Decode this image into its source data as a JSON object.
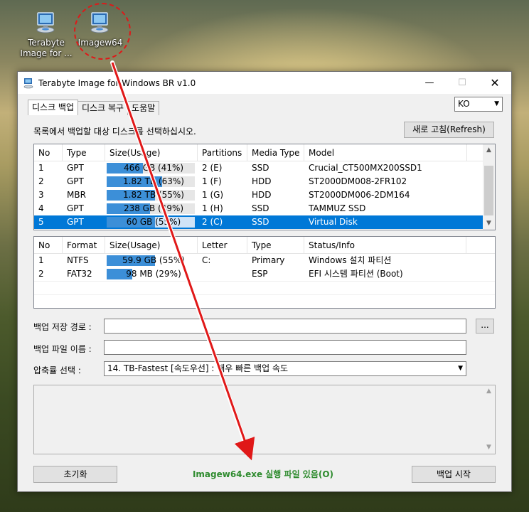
{
  "desktop": {
    "icons": [
      {
        "label_line1": "Terabyte",
        "label_line2": "Image for ...",
        "icon": "computer-disk-icon"
      },
      {
        "label_line1": "Imagew64",
        "label_line2": "",
        "icon": "computer-disk-icon"
      }
    ],
    "highlight_color": "#e01818"
  },
  "window": {
    "title": "Terabyte Image for Windows BR v1.0",
    "controls": {
      "minimize": "—",
      "maximize": "☐",
      "close": "✕"
    },
    "tabs": [
      {
        "label": "디스크 백업",
        "active": true
      },
      {
        "label": "디스크 복구",
        "active": false
      },
      {
        "label": "도움말",
        "active": false
      }
    ],
    "language": {
      "selected": "KO"
    },
    "instruction": "목록에서 백업할 대상 디스크를 선택하십시오.",
    "refresh_button": "새로 고침(Refresh)",
    "disks": {
      "columns": [
        "No",
        "Type",
        "Size(Usage)",
        "Partitions",
        "Media Type",
        "Model"
      ],
      "rows": [
        {
          "no": "1",
          "type": "GPT",
          "size": "466 GB (41%)",
          "usage": 41,
          "partitions": "2 (E)",
          "media": "SSD",
          "model": "Crucial_CT500MX200SSD1",
          "selected": false
        },
        {
          "no": "2",
          "type": "GPT",
          "size": "1.82 TB (63%)",
          "usage": 63,
          "partitions": "1 (F)",
          "media": "HDD",
          "model": "ST2000DM008-2FR102",
          "selected": false
        },
        {
          "no": "3",
          "type": "MBR",
          "size": "1.82 TB (55%)",
          "usage": 55,
          "partitions": "1 (G)",
          "media": "HDD",
          "model": "ST2000DM006-2DM164",
          "selected": false
        },
        {
          "no": "4",
          "type": "GPT",
          "size": "238 GB (49%)",
          "usage": 49,
          "partitions": "1 (H)",
          "media": "SSD",
          "model": "TAMMUZ SSD",
          "selected": false
        },
        {
          "no": "5",
          "type": "GPT",
          "size": "60 GB (55%)",
          "usage": 55,
          "partitions": "2 (C)",
          "media": "SSD",
          "model": "Virtual Disk",
          "selected": true
        }
      ]
    },
    "partitions": {
      "columns": [
        "No",
        "Format",
        "Size(Usage)",
        "Letter",
        "Type",
        "Status/Info"
      ],
      "rows": [
        {
          "no": "1",
          "format": "NTFS",
          "size": "59.9 GB (55%)",
          "usage": 55,
          "letter": "C:",
          "type": "Primary",
          "status": "Windows 설치 파티션"
        },
        {
          "no": "2",
          "format": "FAT32",
          "size": "98 MB (29%)",
          "usage": 29,
          "letter": "",
          "type": "ESP",
          "status": "EFI 시스템 파티션 (Boot)"
        }
      ]
    },
    "backup_path_label": "백업 저장 경로 :",
    "backup_path_value": "",
    "browse_button": "...",
    "backup_name_label": "백업 파일 이름 :",
    "backup_name_value": "",
    "compression_label": "압축률 선택 :",
    "compression_selected": "14. TB-Fastest [속도우선] : 매우 빠른 백업 속도",
    "reset_button": "초기화",
    "status_message": "Imagew64.exe 실행 파일 있음(O)",
    "start_button": "백업 시작",
    "status_color": "#2e8b2e",
    "selection_color": "#0078d7",
    "usage_color": "#3c8fd8"
  }
}
